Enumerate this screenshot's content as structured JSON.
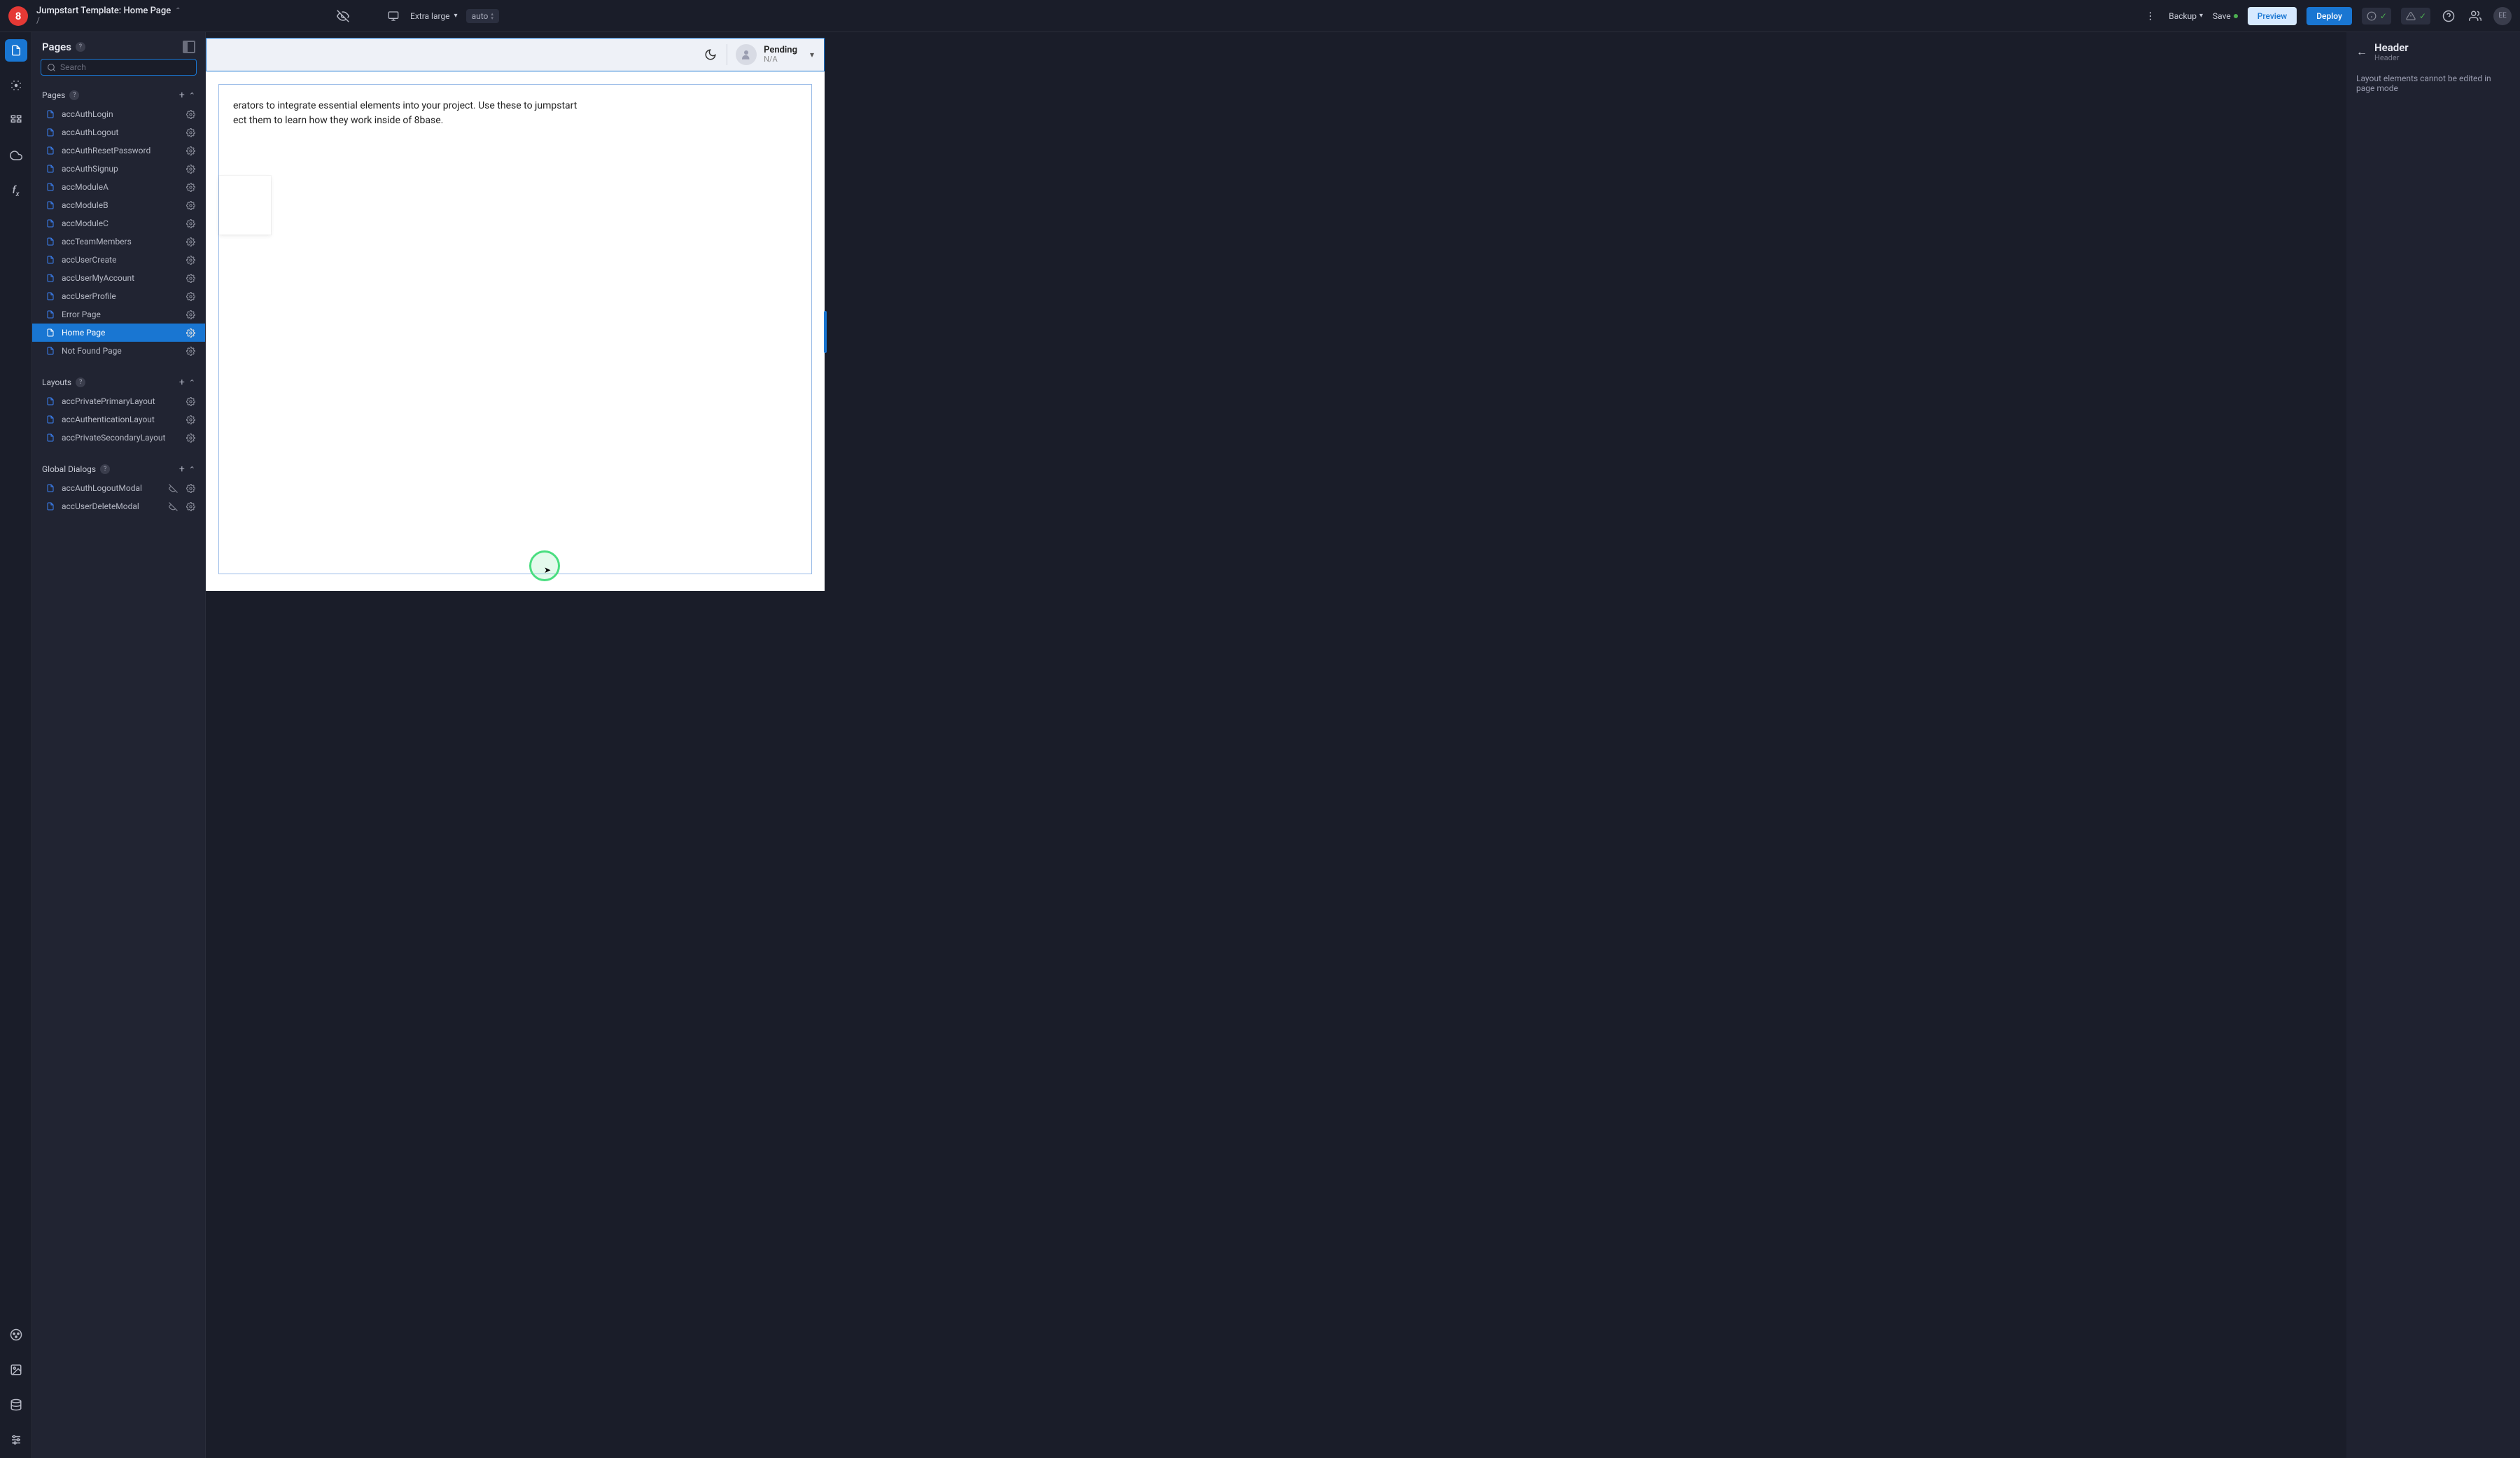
{
  "topbar": {
    "logo_letter": "8",
    "title": "Jumpstart Template: Home Page",
    "path": "/",
    "viewport_label": "Extra large",
    "auto_label": "auto",
    "backup": "Backup",
    "save": "Save",
    "preview": "Preview",
    "deploy": "Deploy",
    "avatar_initials": "EE"
  },
  "panel": {
    "title": "Pages",
    "search_placeholder": "Search",
    "sections": {
      "pages": {
        "label": "Pages"
      },
      "layouts": {
        "label": "Layouts"
      },
      "dialogs": {
        "label": "Global Dialogs"
      }
    },
    "pages": [
      "accAuthLogin",
      "accAuthLogout",
      "accAuthResetPassword",
      "accAuthSignup",
      "accModuleA",
      "accModuleB",
      "accModuleC",
      "accTeamMembers",
      "accUserCreate",
      "accUserMyAccount",
      "accUserProfile",
      "Error Page",
      "Home Page",
      "Not Found Page"
    ],
    "active_page_index": 12,
    "layouts": [
      "accPrivatePrimaryLayout",
      "accAuthenticationLayout",
      "accPrivateSecondaryLayout"
    ],
    "dialogs": [
      "accAuthLogoutModal",
      "accUserDeleteModal"
    ]
  },
  "canvas": {
    "header": {
      "status": "Pending",
      "substatus": "N/A"
    },
    "body_text_line1": "erators to integrate essential elements into your project. Use these to jumpstart",
    "body_text_line2": "ect them to learn how they work inside of 8base."
  },
  "props": {
    "title": "Header",
    "subtitle": "Header",
    "message": "Layout elements cannot be edited in page mode"
  }
}
